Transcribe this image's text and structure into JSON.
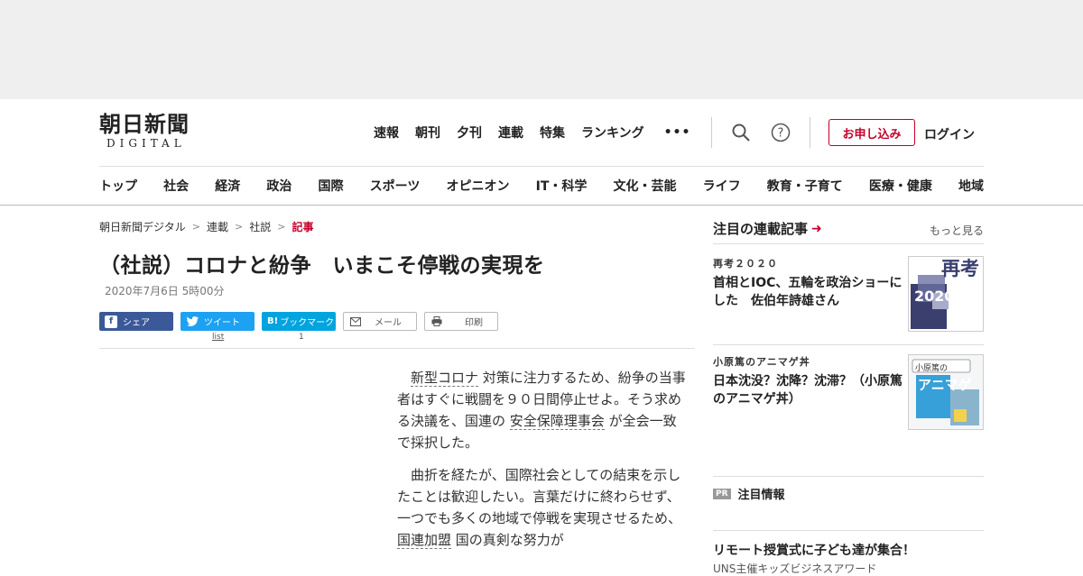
{
  "logo": {
    "ja": "朝日新聞",
    "en": "DIGITAL"
  },
  "topnav": [
    "速報",
    "朝刊",
    "夕刊",
    "連載",
    "特集",
    "ランキング"
  ],
  "topnav_more": "•••",
  "header_actions": {
    "apply": "お申し込み",
    "login": "ログイン"
  },
  "categories": [
    "トップ",
    "社会",
    "経済",
    "政治",
    "国際",
    "スポーツ",
    "オピニオン",
    "IT・科学",
    "文化・芸能",
    "ライフ",
    "教育・子育て",
    "医療・健康",
    "地域"
  ],
  "breadcrumb": [
    "朝日新聞デジタル",
    "連載",
    "社説",
    "記事"
  ],
  "article": {
    "title": "（社説）コロナと紛争　いまこそ停戦の実現を",
    "date": "2020年7月6日 5時00分",
    "p1": {
      "k1": "新型コロナ",
      "t1": " 対策に注力するため、紛争の当事者はすぐに戦闘を９０日間停止せよ。そう求める決議を、国連の ",
      "k2": "安全保障理事会",
      "t2": " が全会一致で採択した。"
    },
    "p2": {
      "t1": "曲折を経たが、国際社会としての結束を示したことは歓迎したい。言葉だけに終わらせず、一つでも多くの地域で停戦を実現させるため、 ",
      "k1": "国連加盟",
      "t2": " 国の真剣な努力が"
    }
  },
  "share": {
    "facebook": "シェア",
    "twitter": "ツイート",
    "hatena": "ブックマーク",
    "hatena_icon": "B!",
    "mail": "メール",
    "print": "印刷",
    "twitter_count": "list",
    "hatena_count": "1"
  },
  "sidebar": {
    "heading": "注目の連載記事",
    "more": "もっと見る",
    "items": [
      {
        "series": "再考２０２０",
        "title": "首相とIOC、五輪を政治ショーにした　佐伯年詩雄さん",
        "thumb_text": "再考",
        "thumb_year": "2020"
      },
      {
        "series": "小原篤のアニマゲ丼",
        "title": "日本沈没？沈降？沈滞？（小原篤のアニマゲ丼）",
        "thumb_text": "小原篤の",
        "thumb_big": "アニマゲ"
      }
    ],
    "pr_badge": "PR",
    "pr_heading": "注目情報",
    "pr_item": "リモート授賞式に子ども達が集合！",
    "pr_sub": "UNS主催キッズビジネスアワード"
  },
  "colors": {
    "accent": "#c4002a",
    "facebook": "#3b5998",
    "twitter": "#1da1f2",
    "hatena": "#00a4de"
  }
}
